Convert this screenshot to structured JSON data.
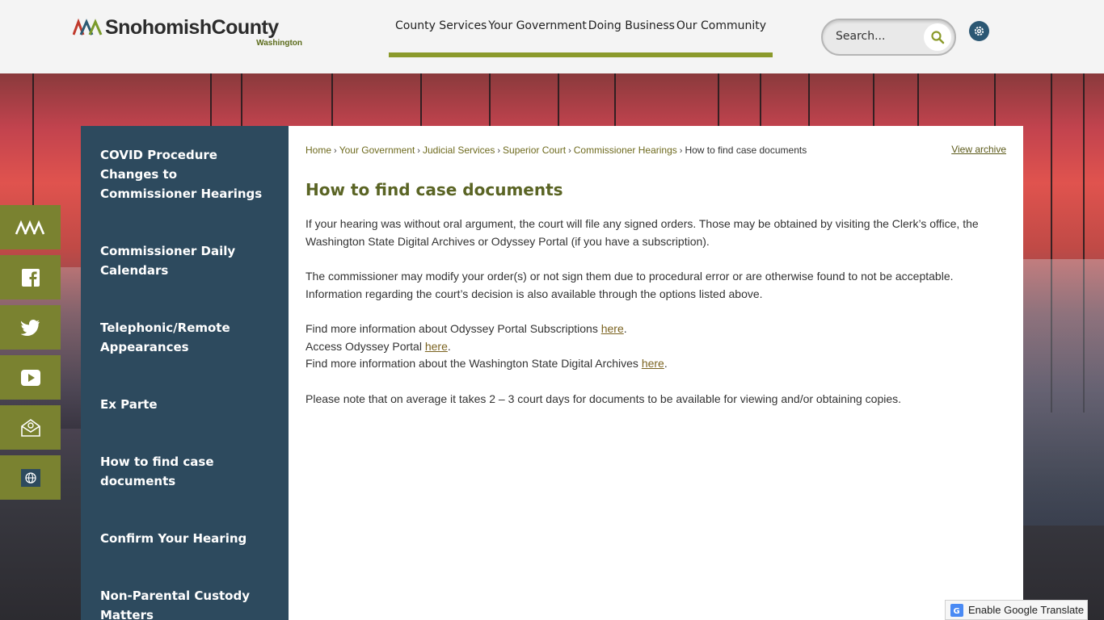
{
  "header": {
    "logo_name": "SnohomishCounty",
    "logo_sub": "Washington",
    "nav": [
      "County Services",
      "Your Government",
      "Doing Business",
      "Our Community"
    ],
    "search_placeholder": "Search..."
  },
  "social": [
    "county-logo-icon",
    "facebook-icon",
    "twitter-icon",
    "youtube-icon",
    "email-icon",
    "translate-globe-icon"
  ],
  "sidebar": {
    "items": [
      "COVID Procedure Changes to Commissioner Hearings",
      "Commissioner Daily Calendars",
      "Telephonic/Remote Appearances",
      "Ex Parte",
      "How to find case documents",
      "Confirm Your Hearing",
      "Non-Parental Custody Matters"
    ]
  },
  "breadcrumb": {
    "links": [
      "Home",
      "Your Government",
      "Judicial Services",
      "Superior Court",
      "Commissioner Hearings"
    ],
    "current": "How to find case documents",
    "separator": "›"
  },
  "view_archive": "View archive",
  "page": {
    "title": "How to find case documents",
    "p1": "If your hearing was without oral argument, the court will file any signed orders.  Those may be obtained by visiting the Clerk’s office, the Washington State Digital Archives or Odyssey Portal (if you have a subscription).",
    "p2": "The commissioner may modify your order(s) or not sign them due to procedural error or are otherwise found to not be acceptable. Information regarding the court’s decision is also available through the options listed above.",
    "line1_text": "Find more information about Odyssey Portal Subscriptions ",
    "line2_text": "Access Odyssey Portal ",
    "line3_text": "Find more information about the Washington State Digital Archives ",
    "link_label": "here",
    "period": ".",
    "p4": "Please note that on average it takes 2 – 3 court days for documents to be available for viewing and/or obtaining copies."
  },
  "translate": {
    "label": "Enable Google Translate"
  },
  "colors": {
    "olive": "#7a8230",
    "sidebar": "#2d4a5e",
    "nav_underline": "#8b9a2b",
    "title": "#5a6424"
  }
}
